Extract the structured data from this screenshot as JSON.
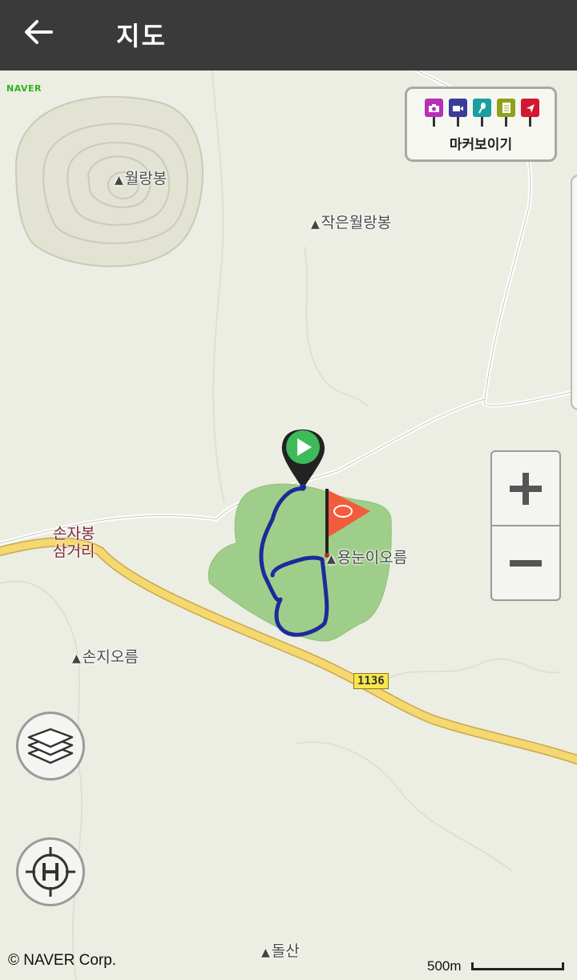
{
  "header": {
    "title": "지도",
    "back_icon": "arrow-left-icon"
  },
  "map": {
    "provider_logo": "NAVER",
    "copyright": "© NAVER Corp.",
    "scale_label": "500m",
    "places": {
      "wollangbong": "월랑봉",
      "small_wollangbong": "작은월랑봉",
      "yongnuni": "용눈이오름",
      "sonji": "손지오름",
      "dolsan": "돌산"
    },
    "junction_line1": "손자봉",
    "junction_line2": "삼거리",
    "road_number": "1136",
    "colors": {
      "land": "#ecede3",
      "forest": "#9fce8a",
      "route": "#1e2a9a",
      "major_road": "#f5d870",
      "flag": "#f25c3c",
      "start_marker": "#3dbb58"
    }
  },
  "marker_panel": {
    "label": "마커보이기",
    "pins": [
      {
        "name": "photo-marker-icon",
        "color": "#b72fb5"
      },
      {
        "name": "video-marker-icon",
        "color": "#3b3b9a"
      },
      {
        "name": "voice-marker-icon",
        "color": "#1a9ea0"
      },
      {
        "name": "memo-marker-icon",
        "color": "#8fa11c"
      },
      {
        "name": "position-marker-icon",
        "color": "#d2172e"
      }
    ]
  },
  "controls": {
    "zoom_in_icon": "plus-icon",
    "zoom_out_icon": "minus-icon",
    "layers_icon": "layers-icon",
    "locate_icon": "helipad-locate-icon"
  }
}
